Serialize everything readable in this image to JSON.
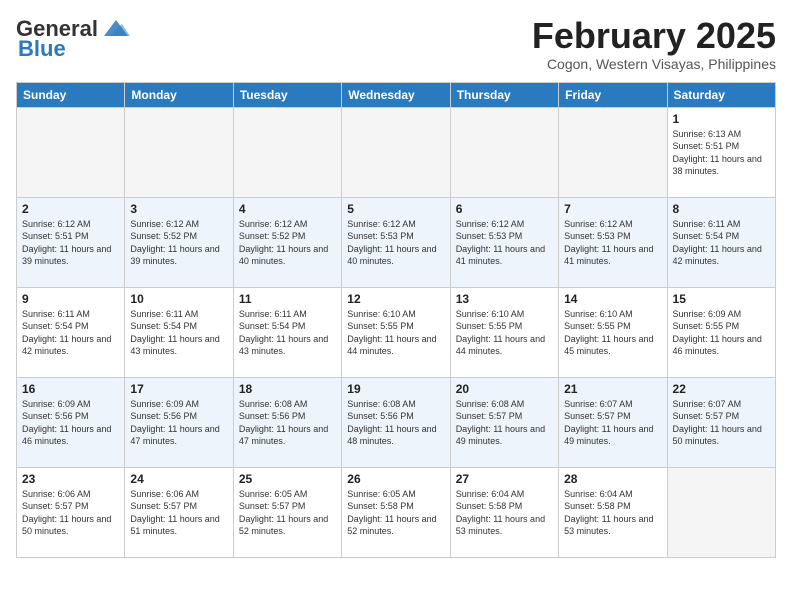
{
  "header": {
    "logo_general": "General",
    "logo_blue": "Blue",
    "month_year": "February 2025",
    "location": "Cogon, Western Visayas, Philippines"
  },
  "days_of_week": [
    "Sunday",
    "Monday",
    "Tuesday",
    "Wednesday",
    "Thursday",
    "Friday",
    "Saturday"
  ],
  "weeks": [
    [
      {
        "day": "",
        "empty": true
      },
      {
        "day": "",
        "empty": true
      },
      {
        "day": "",
        "empty": true
      },
      {
        "day": "",
        "empty": true
      },
      {
        "day": "",
        "empty": true
      },
      {
        "day": "",
        "empty": true
      },
      {
        "day": "1",
        "sunrise": "Sunrise: 6:13 AM",
        "sunset": "Sunset: 5:51 PM",
        "daylight": "Daylight: 11 hours and 38 minutes."
      }
    ],
    [
      {
        "day": "2",
        "sunrise": "Sunrise: 6:12 AM",
        "sunset": "Sunset: 5:51 PM",
        "daylight": "Daylight: 11 hours and 39 minutes."
      },
      {
        "day": "3",
        "sunrise": "Sunrise: 6:12 AM",
        "sunset": "Sunset: 5:52 PM",
        "daylight": "Daylight: 11 hours and 39 minutes."
      },
      {
        "day": "4",
        "sunrise": "Sunrise: 6:12 AM",
        "sunset": "Sunset: 5:52 PM",
        "daylight": "Daylight: 11 hours and 40 minutes."
      },
      {
        "day": "5",
        "sunrise": "Sunrise: 6:12 AM",
        "sunset": "Sunset: 5:53 PM",
        "daylight": "Daylight: 11 hours and 40 minutes."
      },
      {
        "day": "6",
        "sunrise": "Sunrise: 6:12 AM",
        "sunset": "Sunset: 5:53 PM",
        "daylight": "Daylight: 11 hours and 41 minutes."
      },
      {
        "day": "7",
        "sunrise": "Sunrise: 6:12 AM",
        "sunset": "Sunset: 5:53 PM",
        "daylight": "Daylight: 11 hours and 41 minutes."
      },
      {
        "day": "8",
        "sunrise": "Sunrise: 6:11 AM",
        "sunset": "Sunset: 5:54 PM",
        "daylight": "Daylight: 11 hours and 42 minutes."
      }
    ],
    [
      {
        "day": "9",
        "sunrise": "Sunrise: 6:11 AM",
        "sunset": "Sunset: 5:54 PM",
        "daylight": "Daylight: 11 hours and 42 minutes."
      },
      {
        "day": "10",
        "sunrise": "Sunrise: 6:11 AM",
        "sunset": "Sunset: 5:54 PM",
        "daylight": "Daylight: 11 hours and 43 minutes."
      },
      {
        "day": "11",
        "sunrise": "Sunrise: 6:11 AM",
        "sunset": "Sunset: 5:54 PM",
        "daylight": "Daylight: 11 hours and 43 minutes."
      },
      {
        "day": "12",
        "sunrise": "Sunrise: 6:10 AM",
        "sunset": "Sunset: 5:55 PM",
        "daylight": "Daylight: 11 hours and 44 minutes."
      },
      {
        "day": "13",
        "sunrise": "Sunrise: 6:10 AM",
        "sunset": "Sunset: 5:55 PM",
        "daylight": "Daylight: 11 hours and 44 minutes."
      },
      {
        "day": "14",
        "sunrise": "Sunrise: 6:10 AM",
        "sunset": "Sunset: 5:55 PM",
        "daylight": "Daylight: 11 hours and 45 minutes."
      },
      {
        "day": "15",
        "sunrise": "Sunrise: 6:09 AM",
        "sunset": "Sunset: 5:55 PM",
        "daylight": "Daylight: 11 hours and 46 minutes."
      }
    ],
    [
      {
        "day": "16",
        "sunrise": "Sunrise: 6:09 AM",
        "sunset": "Sunset: 5:56 PM",
        "daylight": "Daylight: 11 hours and 46 minutes."
      },
      {
        "day": "17",
        "sunrise": "Sunrise: 6:09 AM",
        "sunset": "Sunset: 5:56 PM",
        "daylight": "Daylight: 11 hours and 47 minutes."
      },
      {
        "day": "18",
        "sunrise": "Sunrise: 6:08 AM",
        "sunset": "Sunset: 5:56 PM",
        "daylight": "Daylight: 11 hours and 47 minutes."
      },
      {
        "day": "19",
        "sunrise": "Sunrise: 6:08 AM",
        "sunset": "Sunset: 5:56 PM",
        "daylight": "Daylight: 11 hours and 48 minutes."
      },
      {
        "day": "20",
        "sunrise": "Sunrise: 6:08 AM",
        "sunset": "Sunset: 5:57 PM",
        "daylight": "Daylight: 11 hours and 49 minutes."
      },
      {
        "day": "21",
        "sunrise": "Sunrise: 6:07 AM",
        "sunset": "Sunset: 5:57 PM",
        "daylight": "Daylight: 11 hours and 49 minutes."
      },
      {
        "day": "22",
        "sunrise": "Sunrise: 6:07 AM",
        "sunset": "Sunset: 5:57 PM",
        "daylight": "Daylight: 11 hours and 50 minutes."
      }
    ],
    [
      {
        "day": "23",
        "sunrise": "Sunrise: 6:06 AM",
        "sunset": "Sunset: 5:57 PM",
        "daylight": "Daylight: 11 hours and 50 minutes."
      },
      {
        "day": "24",
        "sunrise": "Sunrise: 6:06 AM",
        "sunset": "Sunset: 5:57 PM",
        "daylight": "Daylight: 11 hours and 51 minutes."
      },
      {
        "day": "25",
        "sunrise": "Sunrise: 6:05 AM",
        "sunset": "Sunset: 5:57 PM",
        "daylight": "Daylight: 11 hours and 52 minutes."
      },
      {
        "day": "26",
        "sunrise": "Sunrise: 6:05 AM",
        "sunset": "Sunset: 5:58 PM",
        "daylight": "Daylight: 11 hours and 52 minutes."
      },
      {
        "day": "27",
        "sunrise": "Sunrise: 6:04 AM",
        "sunset": "Sunset: 5:58 PM",
        "daylight": "Daylight: 11 hours and 53 minutes."
      },
      {
        "day": "28",
        "sunrise": "Sunrise: 6:04 AM",
        "sunset": "Sunset: 5:58 PM",
        "daylight": "Daylight: 11 hours and 53 minutes."
      },
      {
        "day": "",
        "empty": true
      }
    ]
  ]
}
